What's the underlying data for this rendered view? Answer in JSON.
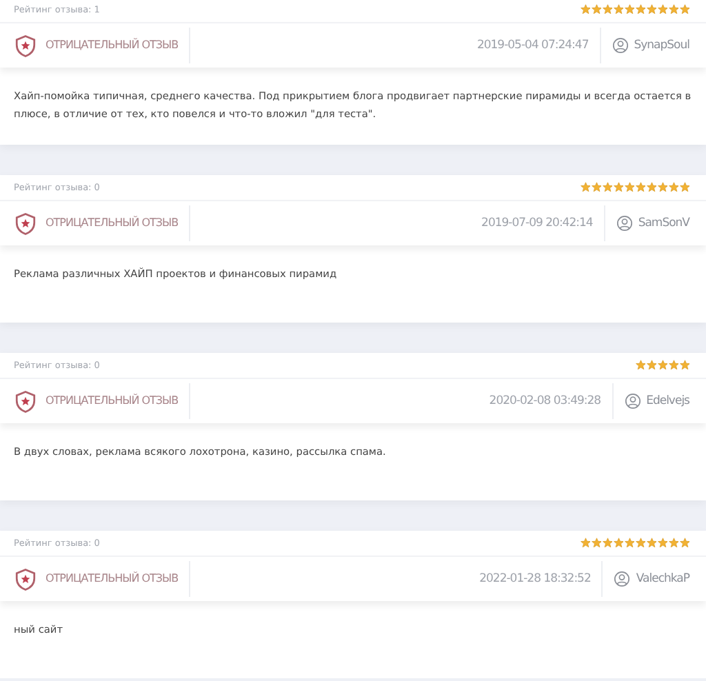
{
  "reviews": [
    {
      "rating_label": "Рейтинг отзыва: 1",
      "stars": 10,
      "type_label": "ОТРИЦАТЕЛЬНЫЙ ОТЗЫВ",
      "date": "2019-05-04 07:24:47",
      "author": "SynapSoul",
      "text": "Хайп-помойка типичная, среднего качества. Под прикрытием блога продвигает партнерские пирамиды и всегда остается в плюсе, в отличие от тех, кто повелся и что-то вложил \"для теста\"."
    },
    {
      "rating_label": "Рейтинг отзыва: 0",
      "stars": 10,
      "type_label": "ОТРИЦАТЕЛЬНЫЙ ОТЗЫВ",
      "date": "2019-07-09 20:42:14",
      "author": "SamSonV",
      "text": "Реклама различных ХАЙП проектов и финансовых пирамид"
    },
    {
      "rating_label": "Рейтинг отзыва: 0",
      "stars": 5,
      "type_label": "ОТРИЦАТЕЛЬНЫЙ ОТЗЫВ",
      "date": "2020-02-08 03:49:28",
      "author": "Edelvejs",
      "text": "В двух словах, реклама всякого лохотрона, казино, рассылка спама."
    },
    {
      "rating_label": "Рейтинг отзыва: 0",
      "stars": 10,
      "type_label": "ОТРИЦАТЕЛЬНЫЙ ОТЗЫВ",
      "date": "2022-01-28 18:32:52",
      "author": "ValechkaP",
      "text": "ный сайт"
    }
  ]
}
